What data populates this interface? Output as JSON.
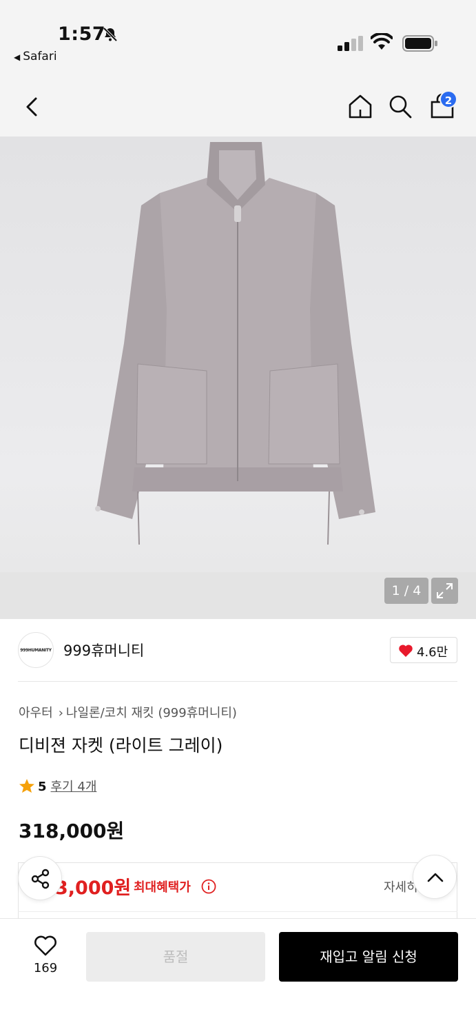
{
  "status_bar": {
    "time": "1:57",
    "back_app": "Safari"
  },
  "nav": {
    "cart_count": "2"
  },
  "gallery": {
    "pager": "1 / 4"
  },
  "brand": {
    "logo_text": "999HUMANITY",
    "name": "999휴머니티",
    "likes": "4.6만"
  },
  "product": {
    "breadcrumb": [
      "아우터",
      "나일론/코치 재킷 (999휴머니티)"
    ],
    "title": "디비젼 자켓 (라이트 그레이)",
    "rating": "5",
    "reviews": "후기 4개",
    "price": "318,000원"
  },
  "benefit": {
    "price": "3,000원",
    "label": "최대혜택가",
    "detail": "자세히"
  },
  "bottom": {
    "wish_count": "169",
    "soldout_label": "품절",
    "restock_label": "재입고 알림 신청"
  },
  "colors": {
    "accent_red": "#e02020",
    "badge_blue": "#2a6bf0",
    "heart": "#e8192c",
    "star": "#f5a10a"
  }
}
